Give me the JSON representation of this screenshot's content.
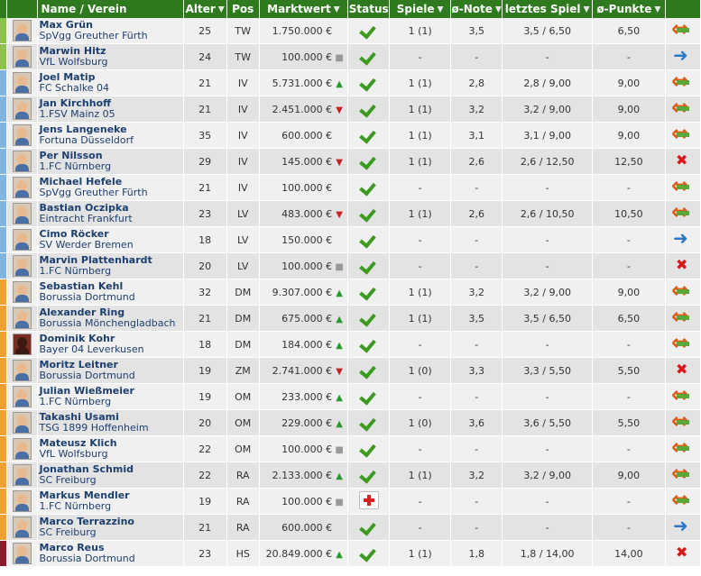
{
  "header": {
    "name": "Name / Verein",
    "age": "Alter",
    "pos": "Pos",
    "value": "Marktwert",
    "status": "Status",
    "games": "Spiele",
    "grade": "ø-Note",
    "last": "letztes Spiel",
    "points": "ø-Punkte"
  },
  "colors": {
    "header_bg": "#2f7a1e",
    "tw": "#8bc34a",
    "iv": "#7fb4e0",
    "dm": "#f0a030",
    "hs": "#8b1a2a"
  },
  "players": [
    {
      "name": "Max Grün",
      "club": "SpVgg Greuther Fürth",
      "age": "25",
      "pos": "TW",
      "value": "1.750.000 €",
      "trend": "none",
      "games": "1 (1)",
      "grade": "3,5",
      "last": "3,5 / 6,50",
      "points": "6,50",
      "action": "swap",
      "status": "check"
    },
    {
      "name": "Marwin Hitz",
      "club": "VfL Wolfsburg",
      "age": "24",
      "pos": "TW",
      "value": "100.000 €",
      "trend": "flat",
      "games": "-",
      "grade": "-",
      "last": "-",
      "points": "-",
      "action": "right",
      "status": "check"
    },
    {
      "name": "Joel Matip",
      "club": "FC Schalke 04",
      "age": "21",
      "pos": "IV",
      "value": "5.731.000 €",
      "trend": "up",
      "games": "1 (1)",
      "grade": "2,8",
      "last": "2,8 / 9,00",
      "points": "9,00",
      "action": "swap",
      "status": "check"
    },
    {
      "name": "Jan Kirchhoff",
      "club": "1.FSV Mainz 05",
      "age": "21",
      "pos": "IV",
      "value": "2.451.000 €",
      "trend": "down",
      "games": "1 (1)",
      "grade": "3,2",
      "last": "3,2 / 9,00",
      "points": "9,00",
      "action": "swap",
      "status": "check"
    },
    {
      "name": "Jens Langeneke",
      "club": "Fortuna Düsseldorf",
      "age": "35",
      "pos": "IV",
      "value": "600.000 €",
      "trend": "none",
      "games": "1 (1)",
      "grade": "3,1",
      "last": "3,1 / 9,00",
      "points": "9,00",
      "action": "swap",
      "status": "check"
    },
    {
      "name": "Per Nilsson",
      "club": "1.FC Nürnberg",
      "age": "29",
      "pos": "IV",
      "value": "145.000 €",
      "trend": "down",
      "games": "1 (1)",
      "grade": "2,6",
      "last": "2,6 / 12,50",
      "points": "12,50",
      "action": "cross",
      "status": "check"
    },
    {
      "name": "Michael Hefele",
      "club": "SpVgg Greuther Fürth",
      "age": "21",
      "pos": "IV",
      "value": "100.000 €",
      "trend": "none",
      "games": "-",
      "grade": "-",
      "last": "-",
      "points": "-",
      "action": "swap",
      "status": "check"
    },
    {
      "name": "Bastian Oczipka",
      "club": "Eintracht Frankfurt",
      "age": "23",
      "pos": "LV",
      "value": "483.000 €",
      "trend": "down",
      "games": "1 (1)",
      "grade": "2,6",
      "last": "2,6 / 10,50",
      "points": "10,50",
      "action": "swap",
      "status": "check"
    },
    {
      "name": "Cimo Röcker",
      "club": "SV Werder Bremen",
      "age": "18",
      "pos": "LV",
      "value": "150.000 €",
      "trend": "none",
      "games": "-",
      "grade": "-",
      "last": "-",
      "points": "-",
      "action": "right",
      "status": "check"
    },
    {
      "name": "Marvin Plattenhardt",
      "club": "1.FC Nürnberg",
      "age": "20",
      "pos": "LV",
      "value": "100.000 €",
      "trend": "flat",
      "games": "-",
      "grade": "-",
      "last": "-",
      "points": "-",
      "action": "cross",
      "status": "check"
    },
    {
      "name": "Sebastian Kehl",
      "club": "Borussia Dortmund",
      "age": "32",
      "pos": "DM",
      "value": "9.307.000 €",
      "trend": "up",
      "games": "1 (1)",
      "grade": "3,2",
      "last": "3,2 / 9,00",
      "points": "9,00",
      "action": "swap",
      "status": "check"
    },
    {
      "name": "Alexander Ring",
      "club": "Borussia Mönchengladbach",
      "age": "21",
      "pos": "DM",
      "value": "675.000 €",
      "trend": "up",
      "games": "1 (1)",
      "grade": "3,5",
      "last": "3,5 / 6,50",
      "points": "6,50",
      "action": "swap",
      "status": "check"
    },
    {
      "name": "Dominik Kohr",
      "club": "Bayer 04 Leverkusen",
      "age": "18",
      "pos": "DM",
      "value": "184.000 €",
      "trend": "up",
      "games": "-",
      "grade": "-",
      "last": "-",
      "points": "-",
      "action": "swap",
      "status": "check",
      "dark": true
    },
    {
      "name": "Moritz Leitner",
      "club": "Borussia Dortmund",
      "age": "19",
      "pos": "ZM",
      "value": "2.741.000 €",
      "trend": "down",
      "games": "1 (0)",
      "grade": "3,3",
      "last": "3,3 / 5,50",
      "points": "5,50",
      "action": "cross",
      "status": "check"
    },
    {
      "name": "Julian Wießmeier",
      "club": "1.FC Nürnberg",
      "age": "19",
      "pos": "OM",
      "value": "233.000 €",
      "trend": "up",
      "games": "-",
      "grade": "-",
      "last": "-",
      "points": "-",
      "action": "swap",
      "status": "check"
    },
    {
      "name": "Takashi Usami",
      "club": "TSG 1899 Hoffenheim",
      "age": "20",
      "pos": "OM",
      "value": "229.000 €",
      "trend": "up",
      "games": "1 (0)",
      "grade": "3,6",
      "last": "3,6 / 5,50",
      "points": "5,50",
      "action": "swap",
      "status": "check"
    },
    {
      "name": "Mateusz Klich",
      "club": "VfL Wolfsburg",
      "age": "22",
      "pos": "OM",
      "value": "100.000 €",
      "trend": "flat",
      "games": "-",
      "grade": "-",
      "last": "-",
      "points": "-",
      "action": "swap",
      "status": "check"
    },
    {
      "name": "Jonathan Schmid",
      "club": "SC Freiburg",
      "age": "22",
      "pos": "RA",
      "value": "2.133.000 €",
      "trend": "up",
      "games": "1 (1)",
      "grade": "3,2",
      "last": "3,2 / 9,00",
      "points": "9,00",
      "action": "swap",
      "status": "check"
    },
    {
      "name": "Markus Mendler",
      "club": "1.FC Nürnberg",
      "age": "19",
      "pos": "RA",
      "value": "100.000 €",
      "trend": "flat",
      "games": "-",
      "grade": "-",
      "last": "-",
      "points": "-",
      "action": "swap",
      "status": "injury"
    },
    {
      "name": "Marco Terrazzino",
      "club": "SC Freiburg",
      "age": "21",
      "pos": "RA",
      "value": "600.000 €",
      "trend": "none",
      "games": "-",
      "grade": "-",
      "last": "-",
      "points": "-",
      "action": "right",
      "status": "check"
    },
    {
      "name": "Marco Reus",
      "club": "Borussia Dortmund",
      "age": "23",
      "pos": "HS",
      "value": "20.849.000 €",
      "trend": "up",
      "games": "1 (1)",
      "grade": "1,8",
      "last": "1,8 / 14,00",
      "points": "14,00",
      "action": "cross",
      "status": "check"
    }
  ]
}
